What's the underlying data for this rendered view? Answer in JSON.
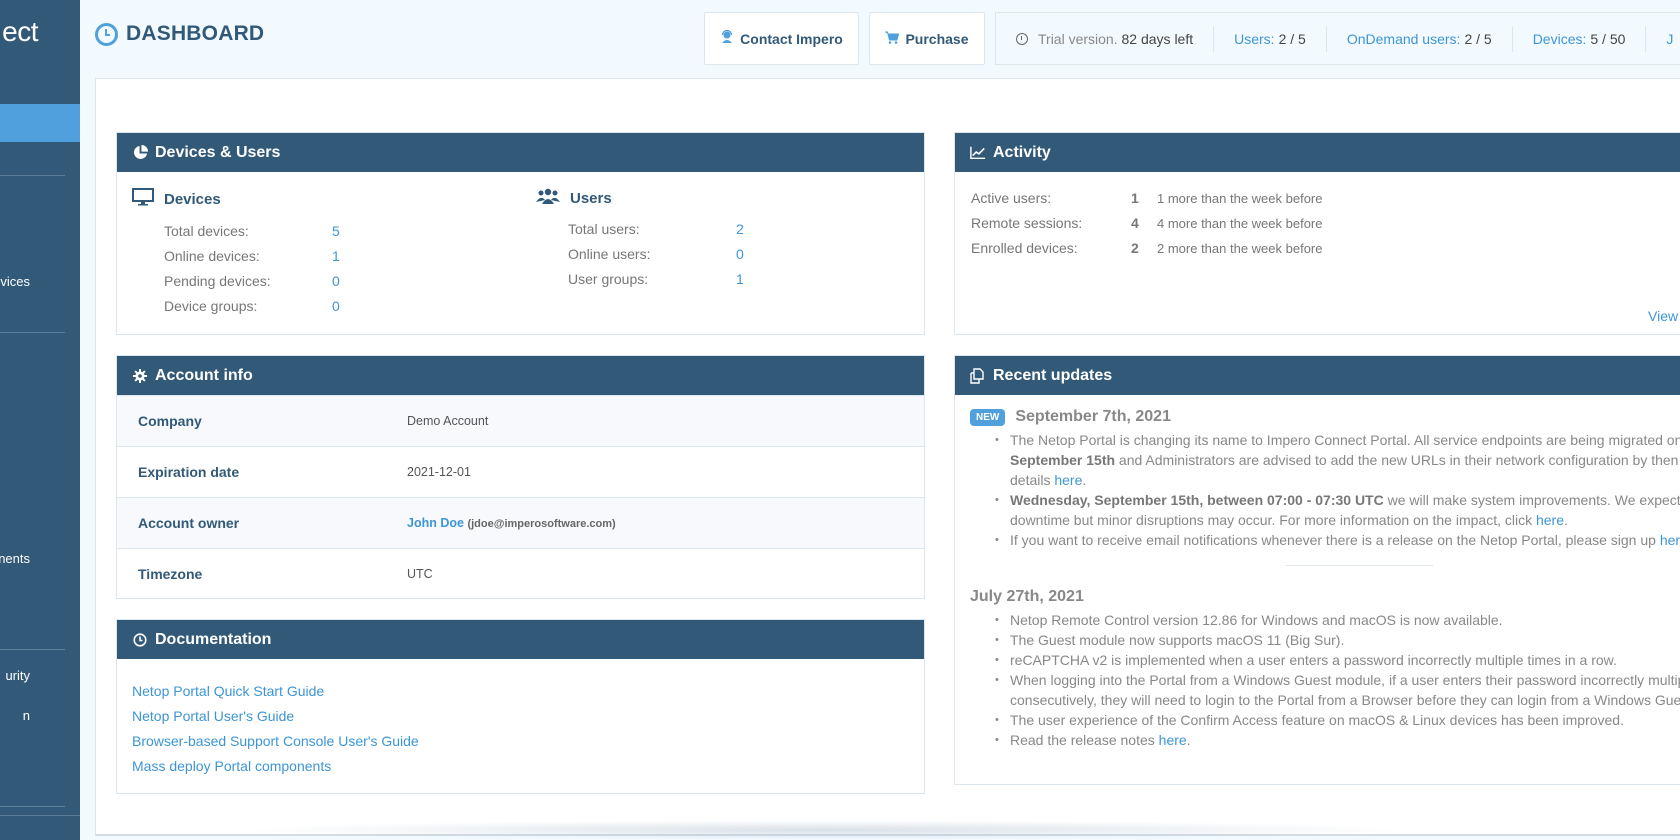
{
  "sidebar": {
    "brand_fragment": "ect",
    "items": [
      {
        "label": "evices"
      },
      {
        "label": "nents"
      },
      {
        "label": "urity"
      },
      {
        "label": "n"
      }
    ]
  },
  "header": {
    "title": "DASHBOARD",
    "contact_button": "Contact Impero",
    "purchase_button": "Purchase",
    "trial_text": "Trial version.",
    "trial_days": "82 days left",
    "users_label": "Users:",
    "users_value": "2 / 5",
    "ondemand_label": "OnDemand users:",
    "ondemand_value": "2 / 5",
    "devices_label": "Devices:",
    "devices_value": "5 / 50",
    "more_fragment": "J"
  },
  "devices_users": {
    "title": "Devices & Users",
    "devices": {
      "heading": "Devices",
      "rows": [
        {
          "label": "Total devices:",
          "value": "5"
        },
        {
          "label": "Online devices:",
          "value": "1"
        },
        {
          "label": "Pending devices:",
          "value": "0"
        },
        {
          "label": "Device groups:",
          "value": "0"
        }
      ]
    },
    "users": {
      "heading": "Users",
      "rows": [
        {
          "label": "Total users:",
          "value": "2"
        },
        {
          "label": "Online users:",
          "value": "0"
        },
        {
          "label": "User groups:",
          "value": "1"
        }
      ]
    }
  },
  "activity": {
    "title": "Activity",
    "rows": [
      {
        "label": "Active users:",
        "value": "1",
        "delta": "1 more than the week before"
      },
      {
        "label": "Remote sessions:",
        "value": "4",
        "delta": "4 more than the week before"
      },
      {
        "label": "Enrolled devices:",
        "value": "2",
        "delta": "2 more than the week before"
      }
    ],
    "view_link": "View"
  },
  "account_info": {
    "title": "Account info",
    "rows": [
      {
        "label": "Company",
        "value": "Demo Account"
      },
      {
        "label": "Expiration date",
        "value": "2021-12-01"
      },
      {
        "label": "Account owner",
        "name": "John Doe",
        "email": "(jdoe@imperosoftware.com)"
      },
      {
        "label": "Timezone",
        "value": "UTC"
      }
    ]
  },
  "documentation": {
    "title": "Documentation",
    "links": [
      "Netop Portal Quick Start Guide",
      "Netop Portal User's Guide",
      "Browser-based Support Console User's Guide",
      "Mass deploy Portal components"
    ]
  },
  "recent_updates": {
    "title": "Recent updates",
    "badge": "NEW",
    "entries": [
      {
        "date": "September 7th, 2021",
        "items": [
          {
            "l1": "The Netop Portal is changing its name to Impero Connect Portal. All service endpoints are being migrated on",
            "l2_bold": "September 15th",
            "l2": " and Administrators are advised to add the new URLs in their network configuration by then",
            "l3": "details ",
            "link": "here",
            "end": "."
          },
          {
            "bold": "Wednesday, September 15th, between 07:00 - 07:30 UTC",
            "l1": " we will make system improvements. We expect",
            "l2": "downtime but minor disruptions may occur. For more information on the impact, click ",
            "link": "here",
            "end": "."
          },
          {
            "l1": "If you want to receive email notifications whenever there is a release on the Netop Portal, please sign up ",
            "link": "here"
          }
        ]
      },
      {
        "date": "July 27th, 2021",
        "items": [
          {
            "text": "Netop Remote Control version 12.86 for Windows and macOS is now available."
          },
          {
            "text": "The Guest module now supports macOS 11 (Big Sur)."
          },
          {
            "text": "reCAPTCHA v2 is implemented when a user enters a password incorrectly multiple times in a row."
          },
          {
            "l1": "When logging into the Portal from a Windows Guest module, if a user enters their password incorrectly multiple",
            "l2": "consecutively, they will need to login to the Portal from a Browser before they can login from a Windows Guest"
          },
          {
            "text": "The user experience of the Confirm Access feature on macOS & Linux devices has been improved."
          },
          {
            "l1": "Read the release notes ",
            "link": "here",
            "end": "."
          }
        ]
      }
    ]
  }
}
